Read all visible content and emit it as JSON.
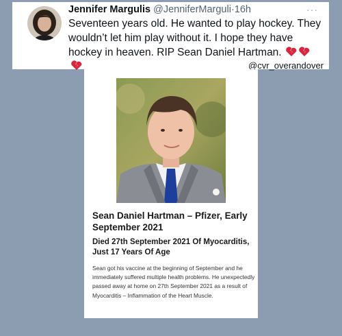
{
  "tweet": {
    "author_name": "Jennifer Margulis",
    "handle": "@JenniferMarguli",
    "separator": "·",
    "time": "16h",
    "more_menu": "···",
    "text": "Seventeen years old. He wanted to play hockey. They wouldn’t let him play without it. I hope they have hockey in heaven. RIP Sean Daniel Hartman.",
    "emoji": [
      "broken-heart-icon",
      "broken-heart-icon",
      "broken-heart-icon"
    ]
  },
  "watermark": "@cvr_overandover",
  "article": {
    "title": "Sean Daniel Hartman – Pfizer, Early September 2021",
    "subtitle": "Died 27th September 2021 Of Myocarditis, Just 17 Years Of Age",
    "body": "Sean got his vaccine at the beginning of September and he immediately suffered multiple health problems. He unexpectedly passed away at home on 27th September 2021 as a result of Myocarditis – Inflammation of the Heart Muscle."
  },
  "colors": {
    "background": "#8d9db1",
    "card": "#ffffff",
    "text": "#0f1419",
    "muted": "#536471",
    "heart": "#d7263d"
  }
}
